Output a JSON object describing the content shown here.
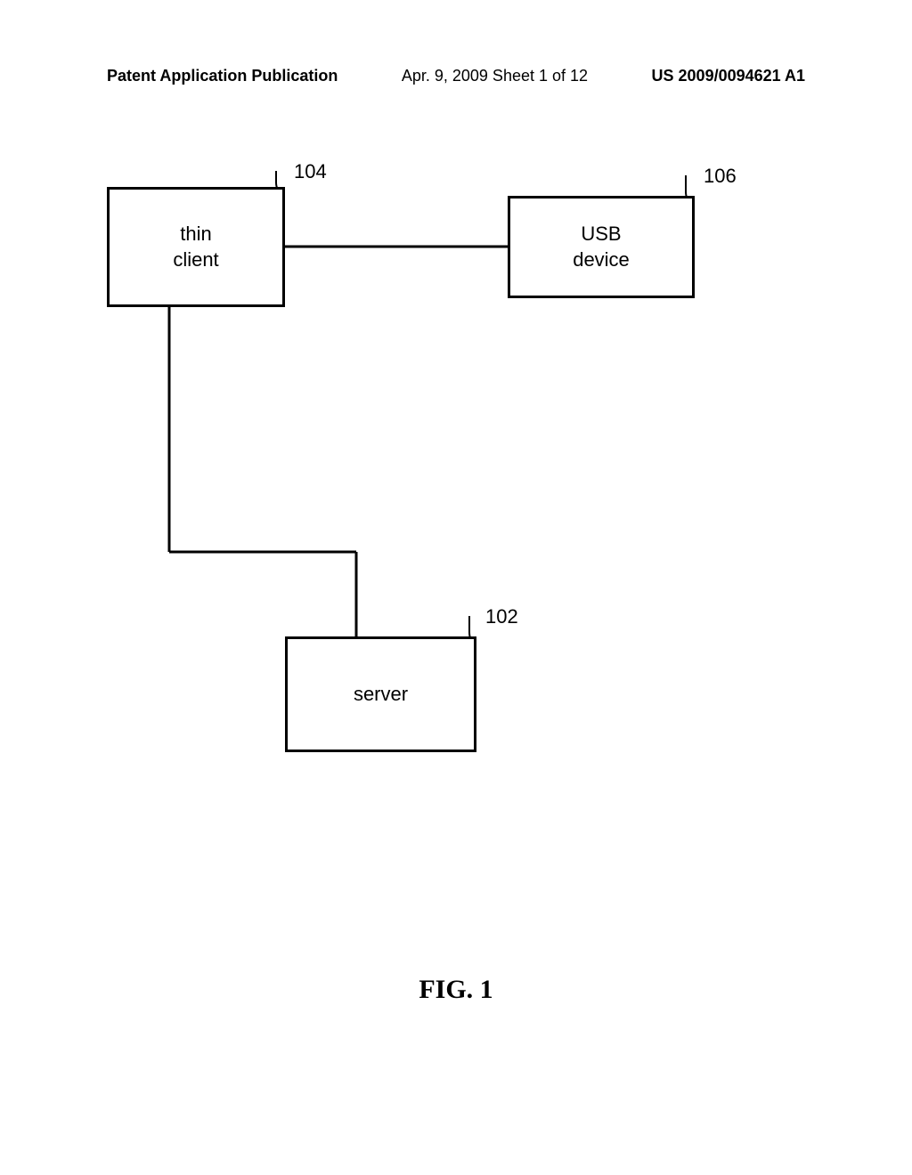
{
  "header": {
    "left": "Patent Application Publication",
    "center": "Apr. 9, 2009  Sheet 1 of 12",
    "right": "US 2009/0094621 A1"
  },
  "diagram": {
    "blocks": {
      "thin_client": {
        "label_line1": "thin",
        "label_line2": "client",
        "ref": "104"
      },
      "usb_device": {
        "label_line1": "USB",
        "label_line2": "device",
        "ref": "106"
      },
      "server": {
        "label": "server",
        "ref": "102"
      }
    }
  },
  "figure_label": "FIG. 1"
}
